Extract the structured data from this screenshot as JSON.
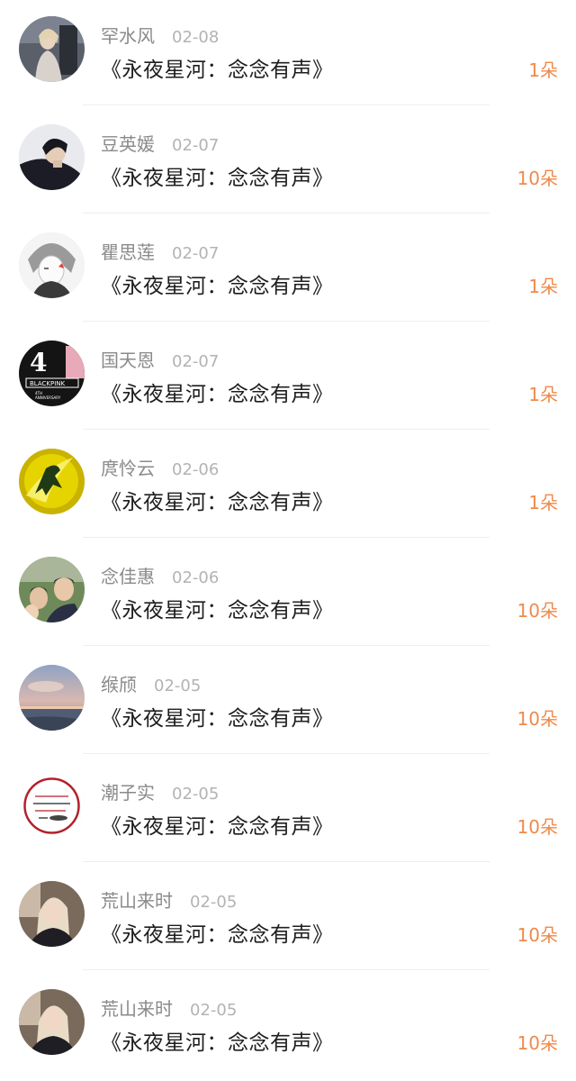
{
  "comments": [
    {
      "name": "罕水风",
      "date": "02-08",
      "title": "《永夜星河：念念有声》",
      "gift": "1朵",
      "avatar_icon": "person-photo-avatar"
    },
    {
      "name": "豆英媛",
      "date": "02-07",
      "title": "《永夜星河：念念有声》",
      "gift": "10朵",
      "avatar_icon": "person-photo-avatar"
    },
    {
      "name": "瞿思莲",
      "date": "02-07",
      "title": "《永夜星河：念念有声》",
      "gift": "1朵",
      "avatar_icon": "anime-avatar"
    },
    {
      "name": "国天恩",
      "date": "02-07",
      "title": "《永夜星河：念念有声》",
      "gift": "1朵",
      "avatar_icon": "blackpink-logo-avatar",
      "avatar_text": [
        "4",
        "BLACKPINK",
        "4TH",
        "ANNIVERSARY"
      ]
    },
    {
      "name": "庹怜云",
      "date": "02-06",
      "title": "《永夜星河：念念有声》",
      "gift": "1朵",
      "avatar_icon": "illustration-avatar"
    },
    {
      "name": "念佳惠",
      "date": "02-06",
      "title": "《永夜星河：念念有声》",
      "gift": "10朵",
      "avatar_icon": "group-photo-avatar"
    },
    {
      "name": "缑颀",
      "date": "02-05",
      "title": "《永夜星河：念念有声》",
      "gift": "10朵",
      "avatar_icon": "sunset-sea-avatar"
    },
    {
      "name": "潮子实",
      "date": "02-05",
      "title": "《永夜星河：念念有声》",
      "gift": "10朵",
      "avatar_icon": "badge-stamp-avatar"
    },
    {
      "name": "荒山来时",
      "date": "02-05",
      "title": "《永夜星河：念念有声》",
      "gift": "10朵",
      "avatar_icon": "person-photo-avatar"
    },
    {
      "name": "荒山来时",
      "date": "02-05",
      "title": "《永夜星河：念念有声》",
      "gift": "10朵",
      "avatar_icon": "person-photo-avatar"
    }
  ],
  "colors": {
    "name": "#8a8a8a",
    "date": "#b3b3b3",
    "title": "#1e1e1e",
    "gift": "#ef8a4a",
    "divider": "#eeeeee"
  }
}
